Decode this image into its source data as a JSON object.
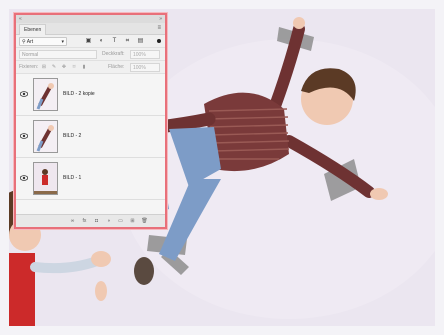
{
  "panel": {
    "title_left": "«",
    "title_right": "»",
    "tab_label": "Ebenen",
    "menu_glyph": "≡",
    "filter": {
      "value": "Art",
      "icons": [
        "image-filter-icon",
        "adjustment-filter-icon",
        "type-filter-icon",
        "shape-filter-icon",
        "smart-object-filter-icon"
      ]
    },
    "blend_mode": "Normal",
    "opacity_label": "Deckkraft:",
    "opacity_value": "100%",
    "lock_label": "Fixieren:",
    "fill_label": "Fläche:",
    "fill_value": "100%",
    "layers": [
      {
        "name": "BILD - 2 kopie",
        "visible": true
      },
      {
        "name": "BILD - 2",
        "visible": true
      },
      {
        "name": "BILD - 1",
        "visible": true
      }
    ],
    "bottom_icons": [
      "link-icon",
      "fx-icon",
      "mask-icon",
      "adjustment-layer-icon",
      "group-icon",
      "new-layer-icon",
      "trash-icon"
    ]
  },
  "colors": {
    "panel_border": "#e8707a",
    "photo_bg": "#e9e3ee",
    "shirt": "#7a3a3a",
    "jeans": "#7d9cc7",
    "tape": "#8a8a8a"
  }
}
